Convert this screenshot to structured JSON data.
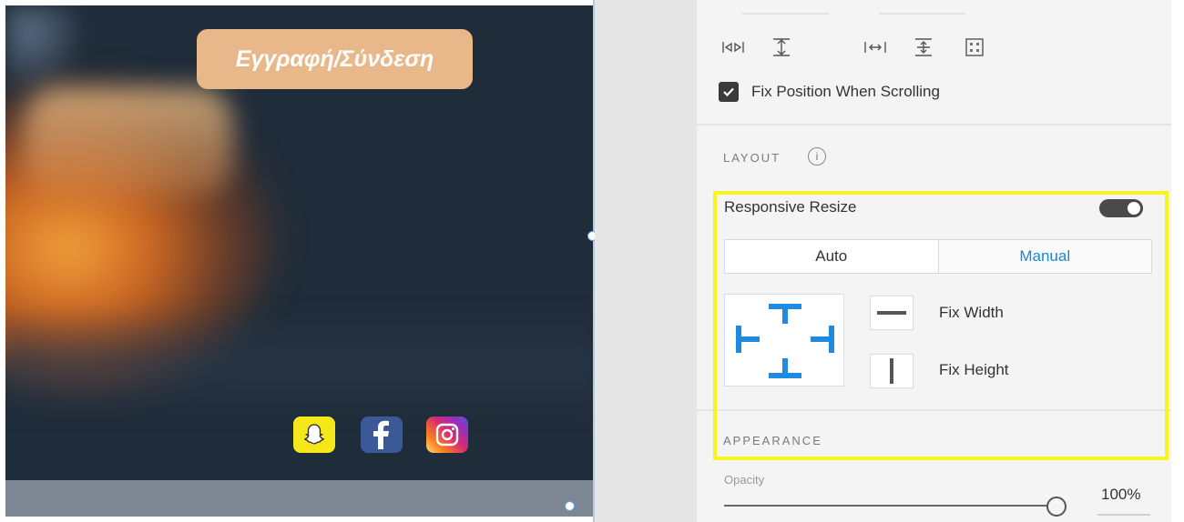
{
  "canvas": {
    "signup_button_label": "Εγγραφή/Σύνδεση",
    "social_icons": [
      "snapchat-icon",
      "facebook-icon",
      "instagram-icon"
    ]
  },
  "panel": {
    "align_icons": [
      "align-left-right-icon",
      "align-top-bottom-icon",
      "distribute-horizontal-icon",
      "distribute-vertical-icon",
      "grid-icon"
    ],
    "fix_position_label": "Fix Position When Scrolling",
    "fix_position_checked": true,
    "layout": {
      "title": "LAYOUT",
      "info_glyph": "i",
      "responsive_resize_label": "Responsive Resize",
      "responsive_resize_on": true,
      "segments": {
        "auto": "Auto",
        "manual": "Manual"
      },
      "selected_segment": "Manual",
      "fix_width_label": "Fix Width",
      "fix_height_label": "Fix Height"
    },
    "appearance": {
      "title": "APPEARANCE",
      "opacity_label": "Opacity",
      "opacity_value": "100%",
      "opacity_fraction": 1.0
    }
  },
  "colors": {
    "canvas_bg": "#1f2c39",
    "signup_button": "#e8b88a",
    "accent_blue": "#1b87d6",
    "highlight_yellow": "#f7f41f"
  }
}
